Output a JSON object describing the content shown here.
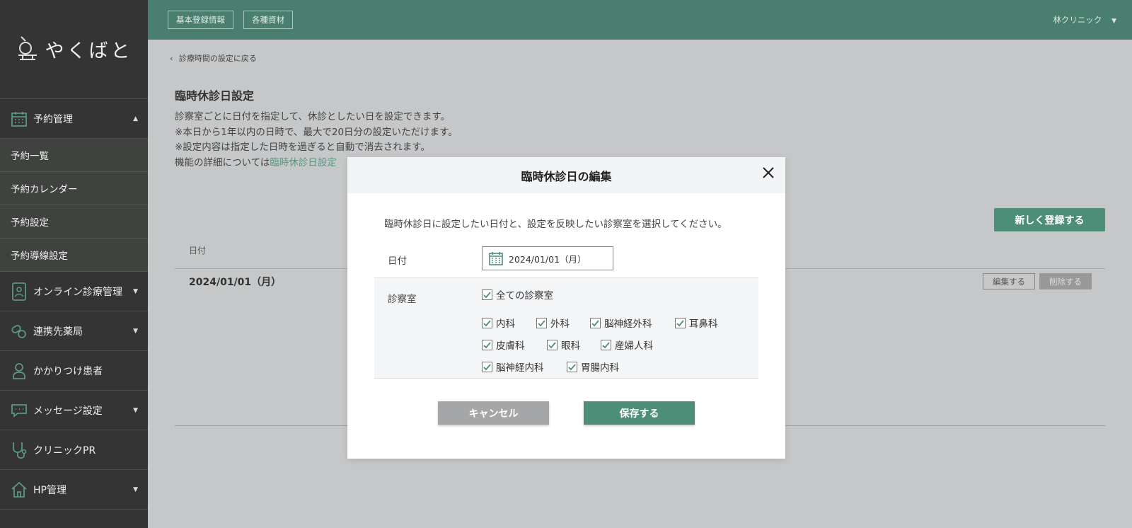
{
  "brand": {
    "name": "やくばと"
  },
  "sidebar": {
    "items": [
      {
        "label": "予約管理",
        "icon": "calendar-icon",
        "arrow": "▲"
      },
      {
        "label": "予約一覧"
      },
      {
        "label": "予約カレンダー"
      },
      {
        "label": "予約設定"
      },
      {
        "label": "予約導線設定"
      },
      {
        "label": "オンライン診療管理",
        "icon": "tablet-doctor-icon",
        "arrow": "▼"
      },
      {
        "label": "連携先薬局",
        "icon": "pills-icon",
        "arrow": "▼"
      },
      {
        "label": "かかりつけ患者",
        "icon": "person-icon"
      },
      {
        "label": "メッセージ設定",
        "icon": "chat-icon",
        "arrow": "▼"
      },
      {
        "label": "クリニックPR",
        "icon": "stethoscope-icon"
      },
      {
        "label": "HP管理",
        "icon": "home-icon",
        "arrow": "▼"
      }
    ]
  },
  "topbar": {
    "buttons": [
      "基本登録情報",
      "各種資材"
    ],
    "clinic": "林クリニック",
    "clinic_arrow": "▼"
  },
  "page": {
    "back_link": "診療時間の設定に戻る",
    "title": "臨時休診日設定",
    "desc_lines": [
      "診察室ごとに日付を指定して、休診としたい日を設定できます。",
      "※本日から1年以内の日時で、最大で20日分の設定いただけます。",
      "※設定内容は指定した日時を過ぎると自動で消去されます。"
    ],
    "desc_prefix": "機能の詳細については",
    "desc_link": "臨時休診日設定",
    "new_button": "新しく登録する",
    "table_header_date": "日付",
    "row_date": "2024/01/01（月）",
    "edit_button": "編集する",
    "delete_button": "削除する"
  },
  "modal": {
    "title": "臨時休診日の編集",
    "instruction": "臨時休診日に設定したい日付と、設定を反映したい診察室を選択してください。",
    "date_label": "日付",
    "date_value": "2024/01/01（月）",
    "room_label": "診察室",
    "all_rooms": "全ての診察室",
    "rooms": [
      "内科",
      "外科",
      "脳神経外科",
      "耳鼻科",
      "皮膚科",
      "眼科",
      "産婦人科",
      "脳神経内科",
      "胃腸内科"
    ],
    "cancel": "キャンセル",
    "save": "保存する"
  },
  "colors": {
    "accent": "#4d8e78",
    "topbar": "#4a7e6e",
    "sidebar": "#333433"
  }
}
